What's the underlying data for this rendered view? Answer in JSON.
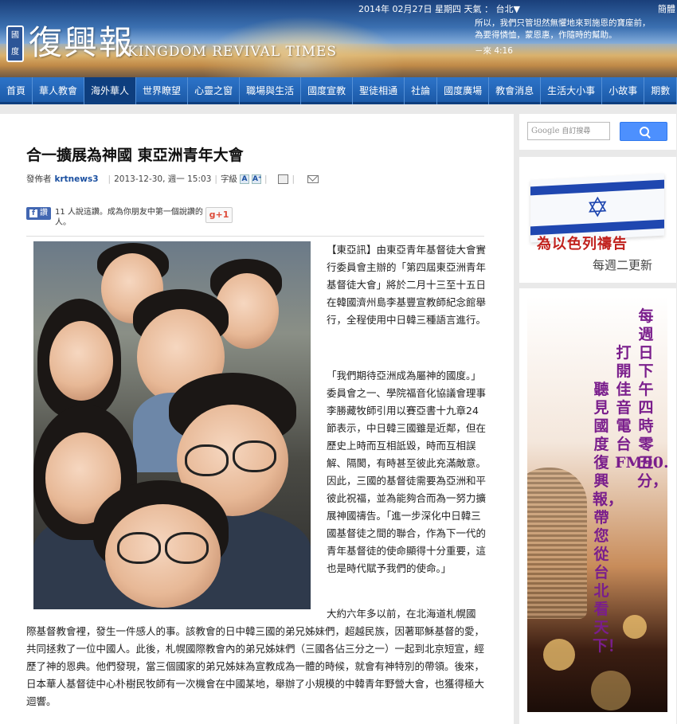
{
  "header": {
    "logo_badge_top": "國",
    "logo_badge_bottom": "度",
    "logo_text": "復興報",
    "logo_en": "KINGDOM REVIVAL TIMES",
    "date_line": "2014年 02月27日 星期四 天氣 ： 台北▼",
    "simp_link": "簡體",
    "verse": "所以，我們只管坦然無懼地來到施恩的寶座前，為要得憐恤，蒙恩惠，作隨時的幫助。",
    "verse_ref": "－來 4:16"
  },
  "nav": {
    "items": [
      "首頁",
      "華人教會",
      "海外華人",
      "世界瞭望",
      "心靈之窗",
      "職場與生活",
      "國度宣教",
      "聖徒相通",
      "社論",
      "國度廣場",
      "教會消息",
      "生活大小事",
      "小故事",
      "期數"
    ],
    "active_index": 2
  },
  "article": {
    "title": "合一擴展為神國 東亞洲青年大會",
    "author_label": "發佈者",
    "author": "krtnews3",
    "date": "2013-12-30, 週一 15:03",
    "size_label": "字級",
    "size_small": "A",
    "size_large": "A⁺",
    "fb_button": "讚",
    "fb_text": "11 人說這讚。成為你朋友中第一個說讚的人。",
    "gplus": "g+1",
    "para1": "【東亞訊】由東亞青年基督徒大會實行委員會主辦的「第四屆東亞洲青年基督徒大會」將於二月十三至十五日在韓國濟州島李基豐宣教師紀念館舉行，全程使用中日韓三種語言進行。",
    "para2": "「我們期待亞洲成為屬神的國度。」委員會之一、學院福音化協議會理事李勝藏牧師引用以賽亞書十九章24節表示，中日韓三國雖是近鄰，但在歷史上時而互相詆毀，時而互相誤解、隔閡，有時甚至彼此充滿敵意。因此，三國的基督徒需要為亞洲和平彼此祝福，並為能夠合而為一努力擴展神國禱告。「進一步深化中日韓三國基督徒之間的聯合，作為下一代的青年基督徒的使命顯得十分重要，這也是時代賦予我們的使命。」",
    "para3_first": "大約六年多以前，在北海道札幌國",
    "para3_rest": "際基督教會裡，發生一件感人的事。該教會的日中韓三國的弟兄姊妹們，超越民族，因著耶穌基督的愛，共同拯救了一位中國人。此後，札幌國際教會內的弟兄姊妹們（三國各佔三分之一）一起到北京短宣，經歷了神的恩典。他們發現，當三個國家的弟兄姊妹為宣教成為一體的時候，就會有神特別的帶領。後來，日本華人基督徒中心朴樹民牧師有一次機會在中國某地，舉辦了小規模的中韓青年野營大會，也獲得極大迴響。"
  },
  "sidebar": {
    "search_placeholder": "自訂搜尋",
    "search_brand": "Google",
    "israel_title": "為以色列禱告",
    "israel_sub": "每週二更新",
    "radio_columns": [
      "每週日下午四時零五分，",
      "打開佳音電台FM90.9，",
      "聽見國度復興報，帶您從台北看天下！"
    ],
    "colors": {
      "col1": "#7a1e8c",
      "col2": "#7a1e8c",
      "col3": "#7a1e8c"
    }
  }
}
